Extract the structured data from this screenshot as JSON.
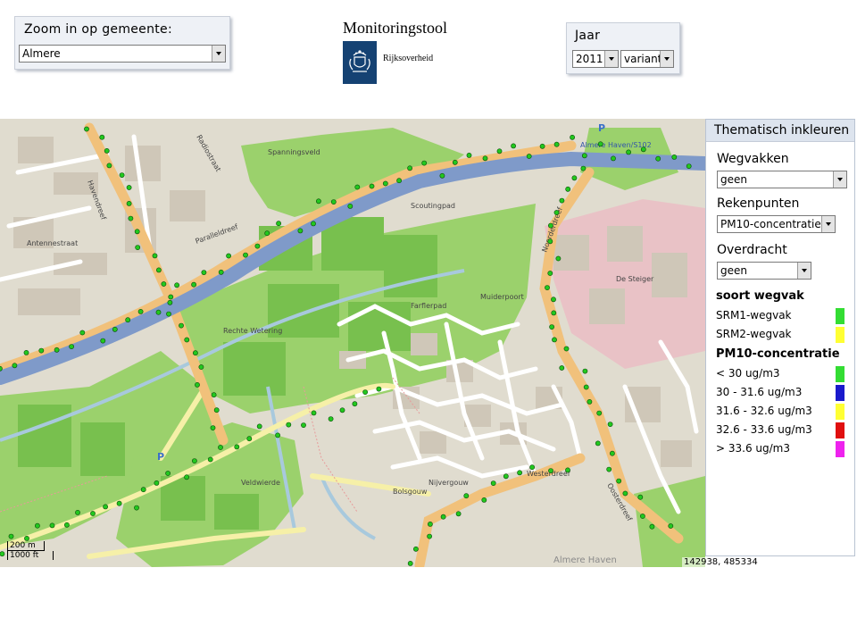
{
  "zoom": {
    "title": "Zoom in op gemeente:",
    "selected": "Almere"
  },
  "logo": {
    "title": "Monitoringstool",
    "subtitle": "Rijksoverheid"
  },
  "year": {
    "title": "Jaar",
    "year_selected": "2011",
    "variant_selected": "variant"
  },
  "map": {
    "scale_metric": "200 m",
    "scale_imperial": "1000 ft",
    "coordinates": "142938, 485334",
    "place": "Almere Haven",
    "streets": [
      "Spanningsveld",
      "Havendreef",
      "Paralleldreef",
      "Scoutingpad",
      "Farflerpad",
      "Muiderpoort",
      "De Steiger",
      "Noorderdreef",
      "Westerdreef",
      "Oosterdreef",
      "Veldwierde",
      "Rechte Wetering",
      "Almere Haven/S102",
      "Antennestraat",
      "Radiostraat",
      "Bolsgouw",
      "Nijvergouw"
    ],
    "colors": {
      "residential": "#e0dccf",
      "park": "#9bd16c",
      "forest": "#78c04e",
      "water": "#a8c9dd",
      "highway": "#7f9ac9",
      "main_road": "#f1c17b",
      "secondary_road": "#f6f0a8",
      "building": "#cfc7b8",
      "commercial": "#e9c2c6",
      "point": "#22c81e"
    }
  },
  "legend": {
    "header": "Thematisch inkleuren",
    "wegvakken_label": "Wegvakken",
    "wegvakken_value": "geen",
    "rekenpunten_label": "Rekenpunten",
    "rekenpunten_value": "PM10-concentratie",
    "overdracht_label": "Overdracht",
    "overdracht_value": "geen",
    "soort_heading": "soort wegvak",
    "soort_items": [
      {
        "label": "SRM1-wegvak",
        "color": "#33dd33"
      },
      {
        "label": "SRM2-wegvak",
        "color": "#ffff33"
      }
    ],
    "pm_heading": "PM10-concentratie",
    "pm_items": [
      {
        "label": "< 30 ug/m3",
        "color": "#33dd33"
      },
      {
        "label": "30 - 31.6 ug/m3",
        "color": "#1a1acc"
      },
      {
        "label": "31.6 - 32.6 ug/m3",
        "color": "#ffff33"
      },
      {
        "label": "32.6 - 33.6 ug/m3",
        "color": "#e01010"
      },
      {
        "label": "> 33.6 ug/m3",
        "color": "#ee22ee"
      }
    ]
  }
}
